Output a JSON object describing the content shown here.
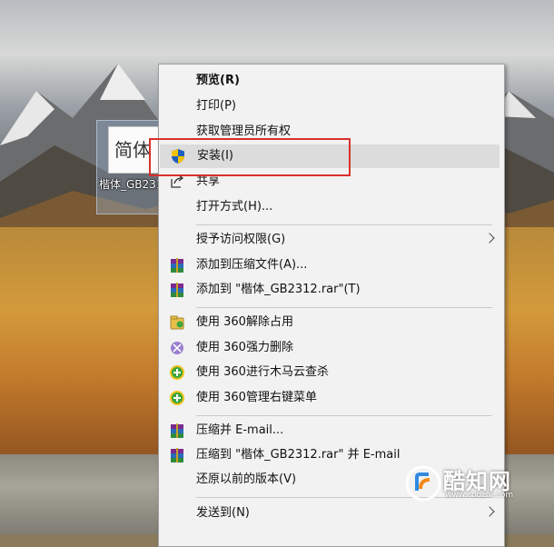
{
  "desktop": {
    "file": {
      "thumbnail_text": "简体",
      "label": "楷体_GB2312..."
    }
  },
  "context_menu": {
    "items": [
      {
        "label": "预览(R)",
        "icon": "",
        "bold": true
      },
      {
        "label": "打印(P)",
        "icon": ""
      },
      {
        "label": "获取管理员所有权",
        "icon": ""
      },
      {
        "label": "安装(I)",
        "icon": "uac-shield-icon",
        "highlighted": true
      },
      {
        "label": "共享",
        "icon": "share-icon"
      },
      {
        "label": "打开方式(H)...",
        "icon": ""
      },
      {
        "label": "授予访问权限(G)",
        "icon": "",
        "submenu": true
      },
      {
        "label": "添加到压缩文件(A)...",
        "icon": "winrar-icon"
      },
      {
        "label": "添加到 \"楷体_GB2312.rar\"(T)",
        "icon": "winrar-icon"
      },
      {
        "label": "使用 360解除占用",
        "icon": "360-unlock-icon"
      },
      {
        "label": "使用 360强力删除",
        "icon": "360-delete-icon"
      },
      {
        "label": "使用 360进行木马云查杀",
        "icon": "360-scan-icon"
      },
      {
        "label": "使用 360管理右键菜单",
        "icon": "360-manage-icon"
      },
      {
        "label": "压缩并 E-mail...",
        "icon": "winrar-icon"
      },
      {
        "label": "压缩到 \"楷体_GB2312.rar\" 并 E-mail",
        "icon": "winrar-icon"
      },
      {
        "label": "还原以前的版本(V)",
        "icon": ""
      },
      {
        "label": "发送到(N)",
        "icon": "",
        "submenu": true
      }
    ]
  },
  "watermark": {
    "name": "酷知网",
    "url": "www.coozhi.com"
  },
  "colors": {
    "menu_bg": "#f2f2f2",
    "highlight_bg": "#dcdcdc",
    "annotation_red": "#d9302b",
    "shield_blue": "#1f5fbf",
    "shield_yellow": "#f2c200"
  }
}
